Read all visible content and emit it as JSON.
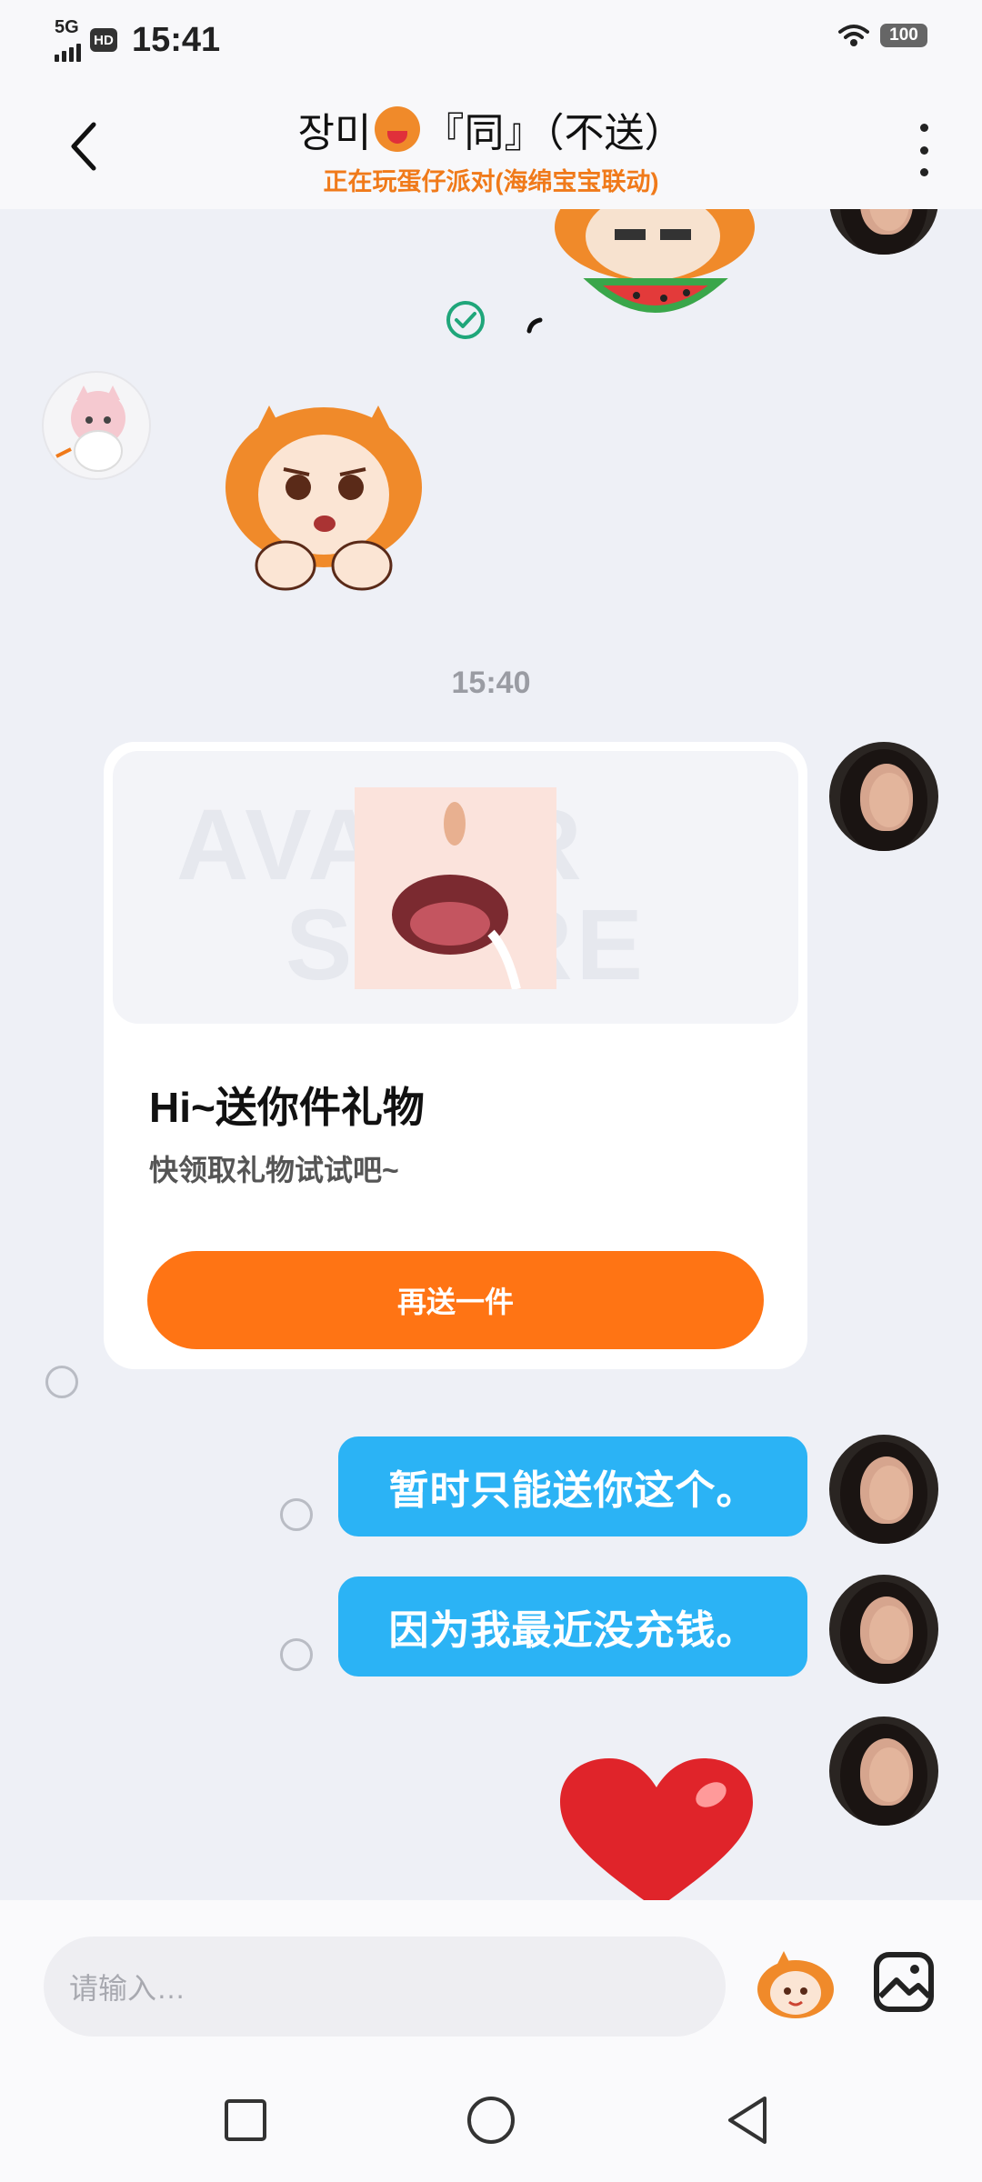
{
  "status_bar": {
    "network": "5G",
    "hd_badge": "HD",
    "time": "15:41",
    "battery": "100"
  },
  "header": {
    "title_prefix": "장미",
    "title_suffix": "『同』（不送）",
    "subtitle": "正在玩蛋仔派对(海绵宝宝联动)"
  },
  "chat": {
    "timestamp": "15:40",
    "gift_card": {
      "watermark_line1": "AVATAR",
      "watermark_line2": "STORE",
      "title": "Hi~送你件礼物",
      "subtitle": "快领取礼物试试吧~",
      "button_label": "再送一件"
    },
    "messages": [
      {
        "text": "暂时只能送你这个。"
      },
      {
        "text": "因为我最近没充钱。"
      }
    ]
  },
  "input": {
    "placeholder": "请输入…"
  },
  "colors": {
    "accent_orange": "#ff7414",
    "bubble_blue": "#2bb3f5",
    "subtitle_orange": "#f07a1a",
    "read_check_green": "#1fa67a"
  }
}
